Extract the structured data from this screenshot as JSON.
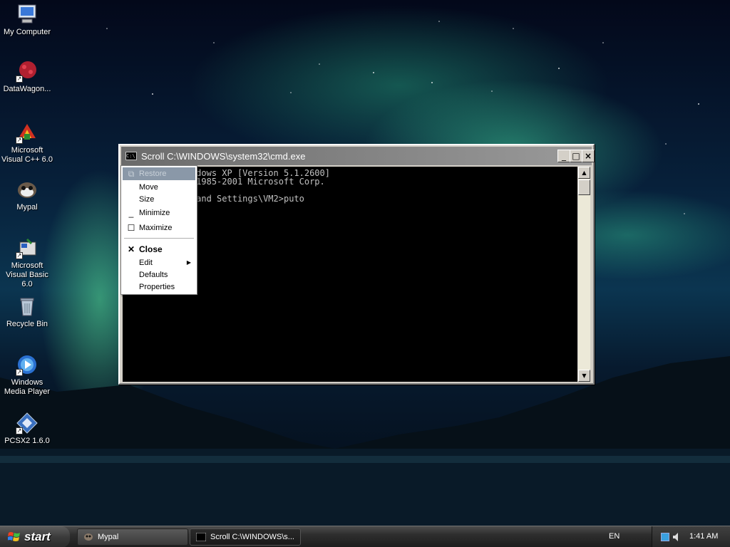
{
  "desktop": {
    "icons": [
      {
        "id": "my-computer",
        "label": "My Computer",
        "shortcut": false
      },
      {
        "id": "datawagon",
        "label": "DataWagon...",
        "shortcut": true
      },
      {
        "id": "visual-cpp",
        "label": "Microsoft Visual C++ 6.0",
        "shortcut": true
      },
      {
        "id": "mypal",
        "label": "Mypal",
        "shortcut": false
      },
      {
        "id": "visual-basic",
        "label": "Microsoft Visual Basic 6.0",
        "shortcut": true
      },
      {
        "id": "recycle-bin",
        "label": "Recycle Bin",
        "shortcut": false
      },
      {
        "id": "wmp",
        "label": "Windows Media Player",
        "shortcut": true
      },
      {
        "id": "pcsx2",
        "label": "PCSX2 1.6.0",
        "shortcut": true
      }
    ]
  },
  "cmd_window": {
    "title": "Scroll C:\\WINDOWS\\system32\\cmd.exe",
    "title_icon_text": "C:\\",
    "buttons": {
      "minimize": "_",
      "maximize": "□",
      "close": "×"
    },
    "console_lines": [
      "              dows XP [Version 5.1.2600]",
      "              1985-2001 Microsoft Corp.",
      "",
      "              and Settings\\VM2>puto"
    ]
  },
  "system_menu": {
    "items": [
      {
        "label": "Restore",
        "glyph": "restore-icon",
        "disabled": true
      },
      {
        "label": "Move"
      },
      {
        "label": "Size"
      },
      {
        "label": "Minimize",
        "glyph": "minimize-icon"
      },
      {
        "label": "Maximize",
        "glyph": "maximize-icon"
      },
      {
        "label": "Close",
        "glyph": "close-icon",
        "bold": true
      },
      {
        "label": "Edit",
        "submenu": true
      },
      {
        "label": "Defaults"
      },
      {
        "label": "Properties"
      }
    ]
  },
  "taskbar": {
    "start_label": "start",
    "tasks": [
      {
        "label": "Mypal",
        "active": false
      },
      {
        "label": "Scroll C:\\WINDOWS\\s...",
        "active": true
      }
    ],
    "language": "EN",
    "clock": "1:41 AM"
  }
}
